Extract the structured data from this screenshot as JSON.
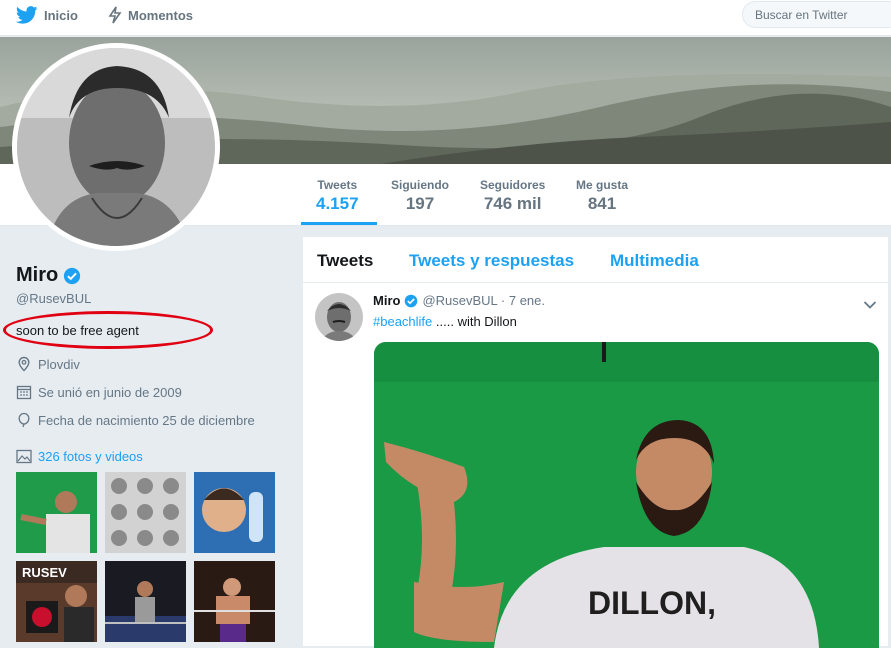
{
  "nav": {
    "home_label": "Inicio",
    "moments_label": "Momentos",
    "search_placeholder": "Buscar en Twitter"
  },
  "stats": [
    {
      "label": "Tweets",
      "value": "4.157"
    },
    {
      "label": "Siguiendo",
      "value": "197"
    },
    {
      "label": "Seguidores",
      "value": "746 mil"
    },
    {
      "label": "Me gusta",
      "value": "841"
    }
  ],
  "profile": {
    "name": "Miro",
    "handle": "@RusevBUL",
    "bio": "soon to be free agent",
    "location": "Plovdiv",
    "joined": "Se unió en junio de 2009",
    "birthday": "Fecha de nacimiento 25 de diciembre",
    "photos_link": "326 fotos y videos"
  },
  "timeline": {
    "tabs": [
      "Tweets",
      "Tweets y respuestas",
      "Multimedia"
    ],
    "tweet": {
      "name": "Miro",
      "handle_time": "@RusevBUL · 7 ene.",
      "hashtag": "#beachlife",
      "text": " ..... with Dillon",
      "shirt_text": "DILLON,"
    }
  },
  "colors": {
    "accent": "#1da1f2",
    "highlight_circle": "#e00012",
    "greenscreen": "#1a9a45"
  }
}
